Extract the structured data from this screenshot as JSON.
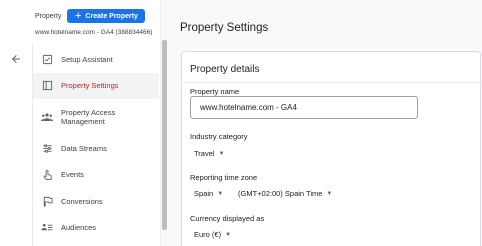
{
  "header": {
    "property_label": "Property",
    "create_button": "Create Property",
    "property_id": "www.hotelname.com - GA4 (388834466)"
  },
  "sidebar": {
    "items": [
      {
        "label": "Setup Assistant",
        "icon": "checklist-icon"
      },
      {
        "label": "Property Settings",
        "icon": "property-settings-icon",
        "active": true
      },
      {
        "label": "Property Access Management",
        "icon": "people-icon"
      },
      {
        "label": "Data Streams",
        "icon": "data-streams-icon"
      },
      {
        "label": "Events",
        "icon": "touch-icon"
      },
      {
        "label": "Conversions",
        "icon": "flag-icon"
      },
      {
        "label": "Audiences",
        "icon": "audiences-icon"
      }
    ]
  },
  "main": {
    "page_title": "Property Settings",
    "card_title": "Property details",
    "property_name_label": "Property name",
    "property_name_value": "www.hotelname.com - GA4",
    "industry_label": "Industry category",
    "industry_value": "Travel",
    "timezone_label": "Reporting time zone",
    "timezone_country": "Spain",
    "timezone_value": "(GMT+02:00) Spain Time",
    "currency_label": "Currency displayed as",
    "currency_value": "Euro (€)"
  },
  "colors": {
    "accent": "#1a73e8",
    "active_text": "#c5221f",
    "active_bg": "#f1f3f4"
  }
}
